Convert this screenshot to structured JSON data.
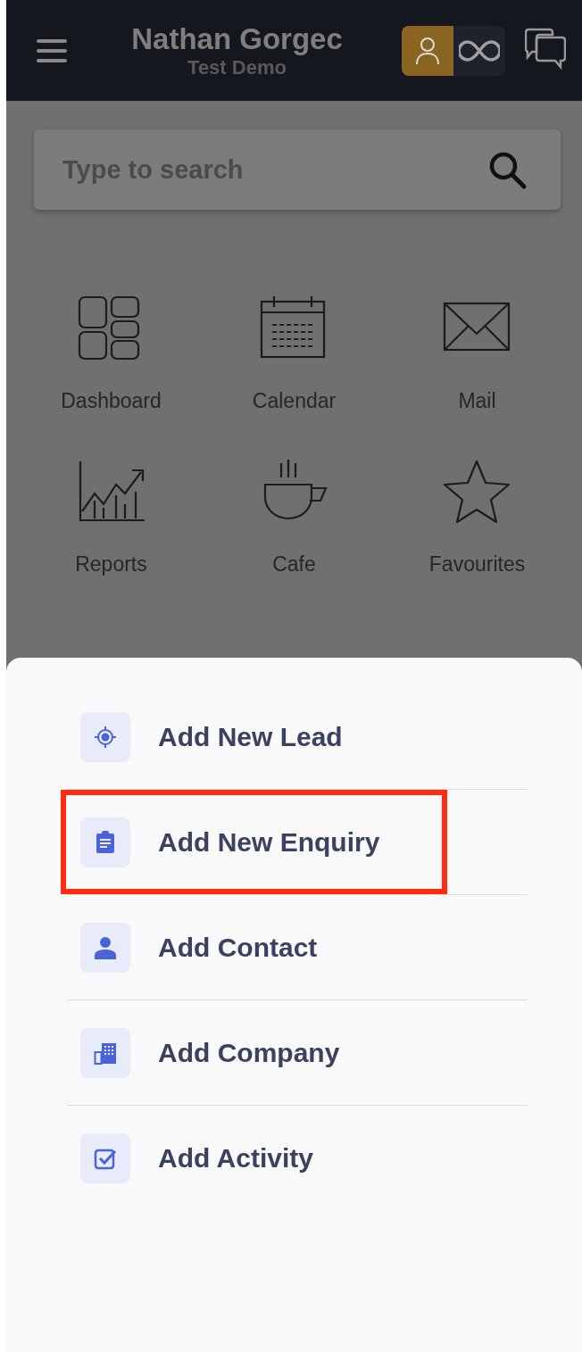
{
  "header": {
    "title": "Nathan Gorgec",
    "subtitle": "Test Demo",
    "mode_toggle": [
      {
        "kind": "user",
        "selected": true
      },
      {
        "kind": "infinity",
        "selected": false
      }
    ]
  },
  "search": {
    "placeholder": "Type to search"
  },
  "apps": [
    {
      "kind": "dashboard",
      "label": "Dashboard"
    },
    {
      "kind": "calendar",
      "label": "Calendar"
    },
    {
      "kind": "mail",
      "label": "Mail"
    },
    {
      "kind": "reports",
      "label": "Reports"
    },
    {
      "kind": "cafe",
      "label": "Cafe"
    },
    {
      "kind": "star",
      "label": "Favourites"
    }
  ],
  "quick_add": [
    {
      "kind": "lead",
      "label": "Add New Lead",
      "highlighted": false
    },
    {
      "kind": "enquiry",
      "label": "Add New Enquiry",
      "highlighted": true
    },
    {
      "kind": "contact",
      "label": "Add Contact",
      "highlighted": false
    },
    {
      "kind": "company",
      "label": "Add Company",
      "highlighted": false
    },
    {
      "kind": "activity",
      "label": "Add Activity",
      "highlighted": false
    }
  ]
}
